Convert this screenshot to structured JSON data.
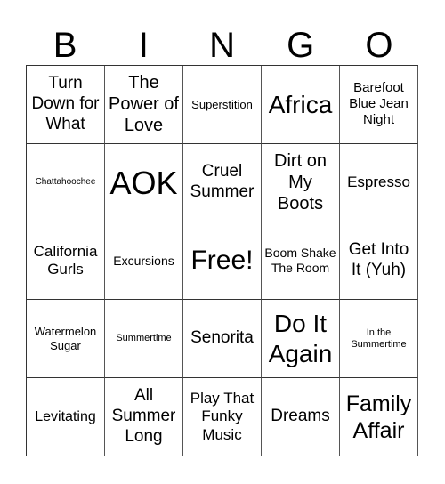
{
  "header": [
    "B",
    "I",
    "N",
    "G",
    "O"
  ],
  "cells": [
    {
      "text": "Turn Down for What",
      "size": 19
    },
    {
      "text": "The Power of Love",
      "size": 20
    },
    {
      "text": "Superstition",
      "size": 13
    },
    {
      "text": "Africa",
      "size": 28
    },
    {
      "text": "Barefoot Blue Jean Night",
      "size": 15
    },
    {
      "text": "Chattahoochee",
      "size": 10
    },
    {
      "text": "AOK",
      "size": 36
    },
    {
      "text": "Cruel Summer",
      "size": 19
    },
    {
      "text": "Dirt on My Boots",
      "size": 20
    },
    {
      "text": "Espresso",
      "size": 17
    },
    {
      "text": "California Gurls",
      "size": 17
    },
    {
      "text": "Excursions",
      "size": 14
    },
    {
      "text": "Free!",
      "size": 30
    },
    {
      "text": "Boom Shake The Room",
      "size": 14
    },
    {
      "text": "Get Into It (Yuh)",
      "size": 19
    },
    {
      "text": "Watermelon Sugar",
      "size": 13
    },
    {
      "text": "Summertime",
      "size": 11
    },
    {
      "text": "Senorita",
      "size": 19
    },
    {
      "text": "Do It Again",
      "size": 28
    },
    {
      "text": "In the Summertime",
      "size": 11
    },
    {
      "text": "Levitating",
      "size": 16
    },
    {
      "text": "All Summer Long",
      "size": 19
    },
    {
      "text": "Play That Funky Music",
      "size": 17
    },
    {
      "text": "Dreams",
      "size": 19
    },
    {
      "text": "Family Affair",
      "size": 25
    }
  ]
}
